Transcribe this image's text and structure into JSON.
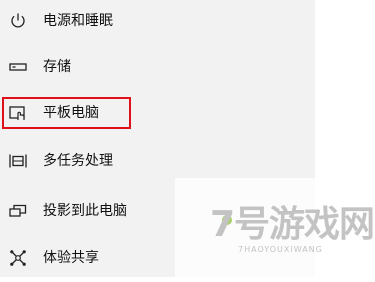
{
  "nav": {
    "items": [
      {
        "label": "电源和睡眠",
        "icon": "power-icon"
      },
      {
        "label": "存储",
        "icon": "storage-icon"
      },
      {
        "label": "平板电脑",
        "icon": "tablet-icon"
      },
      {
        "label": "多任务处理",
        "icon": "multitasking-icon"
      },
      {
        "label": "投影到此电脑",
        "icon": "project-to-pc-icon"
      },
      {
        "label": "体验共享",
        "icon": "shared-experiences-icon"
      }
    ],
    "highlighted_index": 2
  },
  "watermark": {
    "title": "7号游戏网",
    "subtitle": "7HAOYOUXIWANG"
  },
  "colors": {
    "sidebar_bg": "#f2f2f2",
    "highlight_border": "#e0101a",
    "text": "#111111",
    "watermark_accent": "#9ac94a"
  }
}
